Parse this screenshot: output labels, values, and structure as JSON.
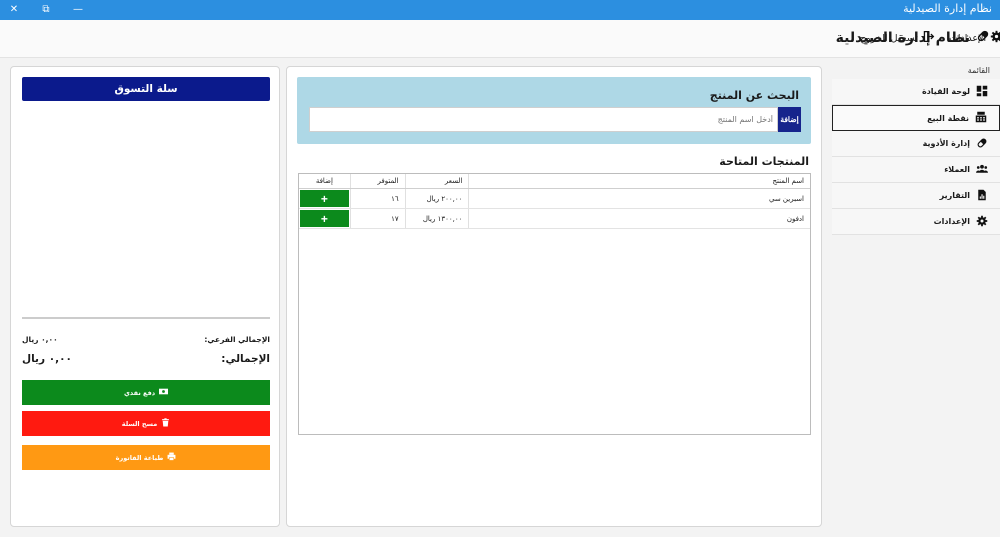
{
  "window": {
    "title": "نظام إدارة الصيدلية",
    "close": "✕",
    "restore": "⧉",
    "minimize": "—"
  },
  "header": {
    "app_title": "نظام إدارة الصيدلية",
    "settings_label": "الإعدادات",
    "logout_label": "تسجيل الخروج"
  },
  "sidebar": {
    "menu_title": "القائمة",
    "items": [
      {
        "label": "لوحة القيادة",
        "icon": "dashboard-icon"
      },
      {
        "label": "نقطة البيع",
        "icon": "cash-register-icon",
        "active": true
      },
      {
        "label": "إدارة الأدوية",
        "icon": "pill-icon"
      },
      {
        "label": "العملاء",
        "icon": "users-icon"
      },
      {
        "label": "التقارير",
        "icon": "report-icon"
      },
      {
        "label": "الإعدادات",
        "icon": "gear-icon"
      }
    ]
  },
  "search": {
    "title": "البحث عن المنتج",
    "placeholder": "أدخل اسم المنتج",
    "add_label": "إضافة"
  },
  "products": {
    "title": "المنتجات المتاحة",
    "columns": {
      "name": "اسم المنتج",
      "price": "السعر",
      "stock": "المتوفر",
      "add": "إضافة"
    },
    "rows": [
      {
        "name": "اسبرين سي",
        "price": "٢٠٠,٠٠ ريال",
        "stock": "١٦",
        "add": "+"
      },
      {
        "name": "ادفون",
        "price": "١٣٠٠,٠٠ ريال",
        "stock": "١٧",
        "add": "+"
      }
    ]
  },
  "cart": {
    "title": "سلة التسوق",
    "subtotal_label": "الإجمالي الفرعي:",
    "subtotal_value": "٠,٠٠ ريال",
    "total_label": "الإجمالي:",
    "total_value": "٠,٠٠ ريال",
    "pay_label": "دفع نقدي",
    "clear_label": "مسح السلة",
    "print_label": "طباعة الفاتورة"
  },
  "colors": {
    "titlebar": "#2c8fe0",
    "navy": "#0b1a8c",
    "green": "#0c8a1c",
    "red": "#ff1a10",
    "orange": "#ff9913",
    "search_bg": "#aed8e6"
  }
}
